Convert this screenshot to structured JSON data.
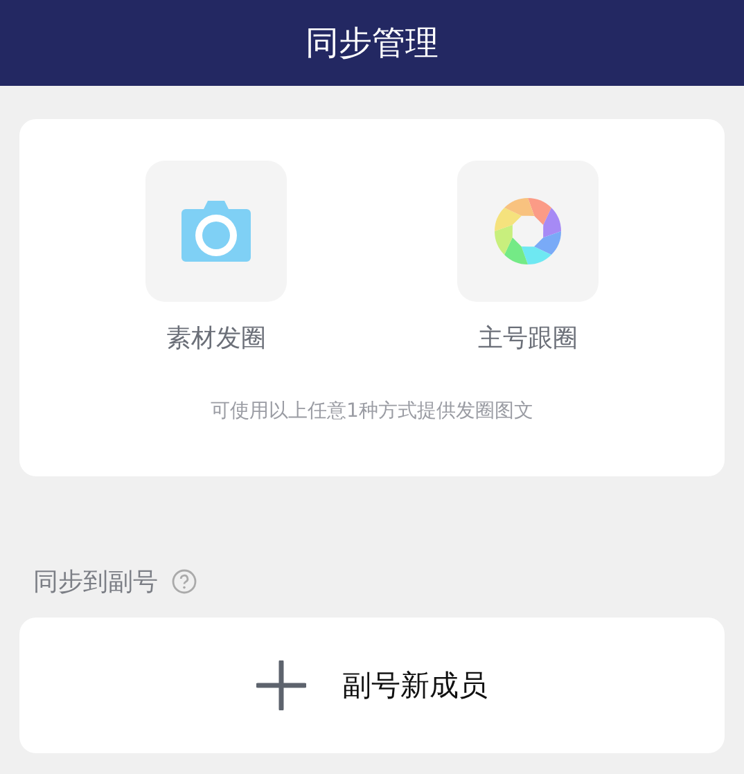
{
  "header": {
    "title": "同步管理"
  },
  "sources": [
    {
      "kind": "camera",
      "label": "素材发圈"
    },
    {
      "kind": "aperture",
      "label": "主号跟圈"
    }
  ],
  "sources_hint": "可使用以上任意1种方式提供发圈图文",
  "sync_section": {
    "title": "同步到副号",
    "add_button": "副号新成员"
  }
}
